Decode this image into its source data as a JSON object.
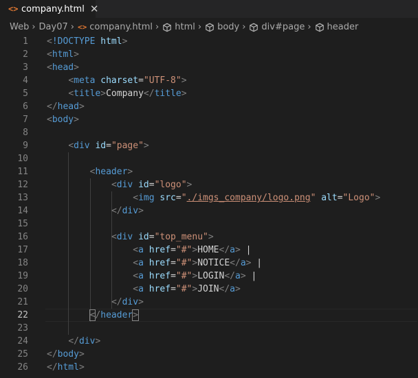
{
  "tab": {
    "file_icon": "<>",
    "label": "company.html",
    "close_icon": "✕"
  },
  "breadcrumb": [
    {
      "label": "Web",
      "icon": null
    },
    {
      "label": "Day07",
      "icon": null
    },
    {
      "label": "company.html",
      "icon": "html-file-icon"
    },
    {
      "label": "html",
      "icon": "element-cube-icon"
    },
    {
      "label": "body",
      "icon": "element-cube-icon"
    },
    {
      "label": "div#page",
      "icon": "element-cube-icon"
    },
    {
      "label": "header",
      "icon": "element-cube-icon"
    }
  ],
  "breadcrumb_icons": {
    "html": "<>"
  },
  "editor": {
    "active_line": 22,
    "colors": {
      "background": "#1e1e1e",
      "tag": "#569cd6",
      "attribute": "#9cdcfe",
      "string": "#ce9178",
      "punctuation": "#808080",
      "text": "#d4d4d4",
      "line_number": "#858585"
    },
    "lines": [
      {
        "n": "1",
        "indent": 0,
        "tokens": [
          [
            "p",
            "<"
          ],
          [
            "tag",
            "!DOCTYPE "
          ],
          [
            "attr",
            "html"
          ],
          [
            "p",
            ">"
          ]
        ]
      },
      {
        "n": "2",
        "indent": 0,
        "tokens": [
          [
            "p",
            "<"
          ],
          [
            "tag",
            "html"
          ],
          [
            "p",
            ">"
          ]
        ]
      },
      {
        "n": "3",
        "indent": 0,
        "tokens": [
          [
            "p",
            "<"
          ],
          [
            "tag",
            "head"
          ],
          [
            "p",
            ">"
          ]
        ]
      },
      {
        "n": "4",
        "indent": 1,
        "tokens": [
          [
            "p",
            "<"
          ],
          [
            "tag",
            "meta "
          ],
          [
            "attr",
            "charset"
          ],
          [
            "text",
            "="
          ],
          [
            "str",
            "\"UTF-8\""
          ],
          [
            "p",
            ">"
          ]
        ]
      },
      {
        "n": "5",
        "indent": 1,
        "tokens": [
          [
            "p",
            "<"
          ],
          [
            "tag",
            "title"
          ],
          [
            "p",
            ">"
          ],
          [
            "text",
            "Company"
          ],
          [
            "p",
            "</"
          ],
          [
            "tag",
            "title"
          ],
          [
            "p",
            ">"
          ]
        ]
      },
      {
        "n": "6",
        "indent": 0,
        "tokens": [
          [
            "p",
            "</"
          ],
          [
            "tag",
            "head"
          ],
          [
            "p",
            ">"
          ]
        ]
      },
      {
        "n": "7",
        "indent": 0,
        "tokens": [
          [
            "p",
            "<"
          ],
          [
            "tag",
            "body"
          ],
          [
            "p",
            ">"
          ]
        ]
      },
      {
        "n": "8",
        "indent": 0,
        "tokens": []
      },
      {
        "n": "9",
        "indent": 1,
        "tokens": [
          [
            "p",
            "<"
          ],
          [
            "tag",
            "div "
          ],
          [
            "attr",
            "id"
          ],
          [
            "text",
            "="
          ],
          [
            "str",
            "\"page\""
          ],
          [
            "p",
            ">"
          ]
        ]
      },
      {
        "n": "10",
        "indent": 0,
        "tokens": []
      },
      {
        "n": "11",
        "indent": 2,
        "tokens": [
          [
            "p",
            "<"
          ],
          [
            "tag",
            "header"
          ],
          [
            "p",
            ">"
          ]
        ]
      },
      {
        "n": "12",
        "indent": 3,
        "tokens": [
          [
            "p",
            "<"
          ],
          [
            "tag",
            "div "
          ],
          [
            "attr",
            "id"
          ],
          [
            "text",
            "="
          ],
          [
            "str",
            "\"logo\""
          ],
          [
            "p",
            ">"
          ]
        ]
      },
      {
        "n": "13",
        "indent": 4,
        "tokens": [
          [
            "p",
            "<"
          ],
          [
            "tag",
            "img "
          ],
          [
            "attr",
            "src"
          ],
          [
            "text",
            "="
          ],
          [
            "str",
            "\""
          ],
          [
            "link",
            "./imgs_company/logo.png"
          ],
          [
            "str",
            "\""
          ],
          [
            "text",
            " "
          ],
          [
            "attr",
            "alt"
          ],
          [
            "text",
            "="
          ],
          [
            "str",
            "\"Logo\""
          ],
          [
            "p",
            ">"
          ]
        ]
      },
      {
        "n": "14",
        "indent": 3,
        "tokens": [
          [
            "p",
            "</"
          ],
          [
            "tag",
            "div"
          ],
          [
            "p",
            ">"
          ]
        ]
      },
      {
        "n": "15",
        "indent": 0,
        "tokens": []
      },
      {
        "n": "16",
        "indent": 3,
        "tokens": [
          [
            "p",
            "<"
          ],
          [
            "tag",
            "div "
          ],
          [
            "attr",
            "id"
          ],
          [
            "text",
            "="
          ],
          [
            "str",
            "\"top_menu\""
          ],
          [
            "p",
            ">"
          ]
        ]
      },
      {
        "n": "17",
        "indent": 4,
        "tokens": [
          [
            "p",
            "<"
          ],
          [
            "tag",
            "a "
          ],
          [
            "attr",
            "href"
          ],
          [
            "text",
            "="
          ],
          [
            "str",
            "\"#\""
          ],
          [
            "p",
            ">"
          ],
          [
            "text",
            "HOME"
          ],
          [
            "p",
            "</"
          ],
          [
            "tag",
            "a"
          ],
          [
            "p",
            ">"
          ],
          [
            "text",
            " |"
          ]
        ]
      },
      {
        "n": "18",
        "indent": 4,
        "tokens": [
          [
            "p",
            "<"
          ],
          [
            "tag",
            "a "
          ],
          [
            "attr",
            "href"
          ],
          [
            "text",
            "="
          ],
          [
            "str",
            "\"#\""
          ],
          [
            "p",
            ">"
          ],
          [
            "text",
            "NOTICE"
          ],
          [
            "p",
            "</"
          ],
          [
            "tag",
            "a"
          ],
          [
            "p",
            ">"
          ],
          [
            "text",
            " |"
          ]
        ]
      },
      {
        "n": "19",
        "indent": 4,
        "tokens": [
          [
            "p",
            "<"
          ],
          [
            "tag",
            "a "
          ],
          [
            "attr",
            "href"
          ],
          [
            "text",
            "="
          ],
          [
            "str",
            "\"#\""
          ],
          [
            "p",
            ">"
          ],
          [
            "text",
            "LOGIN"
          ],
          [
            "p",
            "</"
          ],
          [
            "tag",
            "a"
          ],
          [
            "p",
            ">"
          ],
          [
            "text",
            " |"
          ]
        ]
      },
      {
        "n": "20",
        "indent": 4,
        "tokens": [
          [
            "p",
            "<"
          ],
          [
            "tag",
            "a "
          ],
          [
            "attr",
            "href"
          ],
          [
            "text",
            "="
          ],
          [
            "str",
            "\"#\""
          ],
          [
            "p",
            ">"
          ],
          [
            "text",
            "JOIN"
          ],
          [
            "p",
            "</"
          ],
          [
            "tag",
            "a"
          ],
          [
            "p",
            ">"
          ]
        ]
      },
      {
        "n": "21",
        "indent": 3,
        "tokens": [
          [
            "p",
            "</"
          ],
          [
            "tag",
            "div"
          ],
          [
            "p",
            ">"
          ]
        ]
      },
      {
        "n": "22",
        "indent": 2,
        "tokens": [
          [
            "cursor",
            "<"
          ],
          [
            "p",
            "/"
          ],
          [
            "tag",
            "header"
          ],
          [
            "cursor",
            ">"
          ]
        ]
      },
      {
        "n": "23",
        "indent": 0,
        "tokens": []
      },
      {
        "n": "24",
        "indent": 1,
        "tokens": [
          [
            "p",
            "</"
          ],
          [
            "tag",
            "div"
          ],
          [
            "p",
            ">"
          ]
        ]
      },
      {
        "n": "25",
        "indent": 0,
        "tokens": [
          [
            "p",
            "</"
          ],
          [
            "tag",
            "body"
          ],
          [
            "p",
            ">"
          ]
        ]
      },
      {
        "n": "26",
        "indent": 0,
        "tokens": [
          [
            "p",
            "</"
          ],
          [
            "tag",
            "html"
          ],
          [
            "p",
            ">"
          ]
        ]
      }
    ]
  }
}
